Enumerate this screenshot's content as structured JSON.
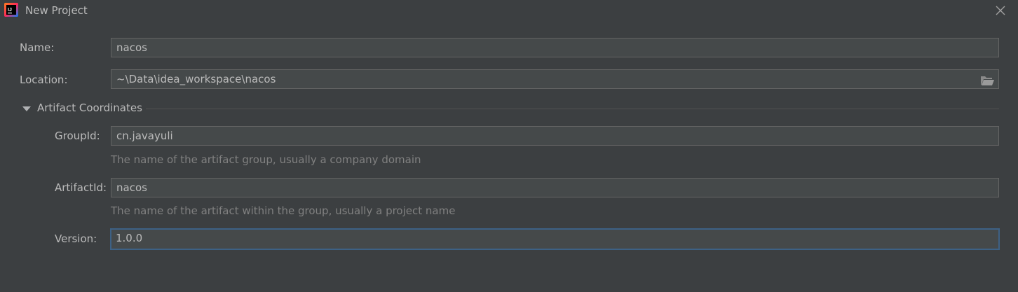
{
  "window": {
    "title": "New Project",
    "icon": "intellij-idea-icon",
    "close_icon": "close-icon"
  },
  "form": {
    "name": {
      "label": "Name:",
      "value": "nacos"
    },
    "location": {
      "label": "Location:",
      "value": "~\\Data\\idea_workspace\\nacos",
      "browse_icon": "folder-icon"
    },
    "artifact_section": {
      "title": "Artifact Coordinates",
      "expanded": true,
      "group_id": {
        "label": "GroupId:",
        "value": "cn.javayuli",
        "hint": "The name of the artifact group, usually a company domain"
      },
      "artifact_id": {
        "label": "ArtifactId:",
        "value": "nacos",
        "hint": "The name of the artifact within the group, usually a project name"
      },
      "version": {
        "label": "Version:",
        "value": "1.0.0",
        "focused": true
      }
    }
  },
  "colors": {
    "background": "#3c3f41",
    "field_background": "#45494a",
    "field_border": "#646464",
    "focus_border": "#3d6185",
    "text": "#bbbbbb",
    "hint_text": "#808080"
  }
}
